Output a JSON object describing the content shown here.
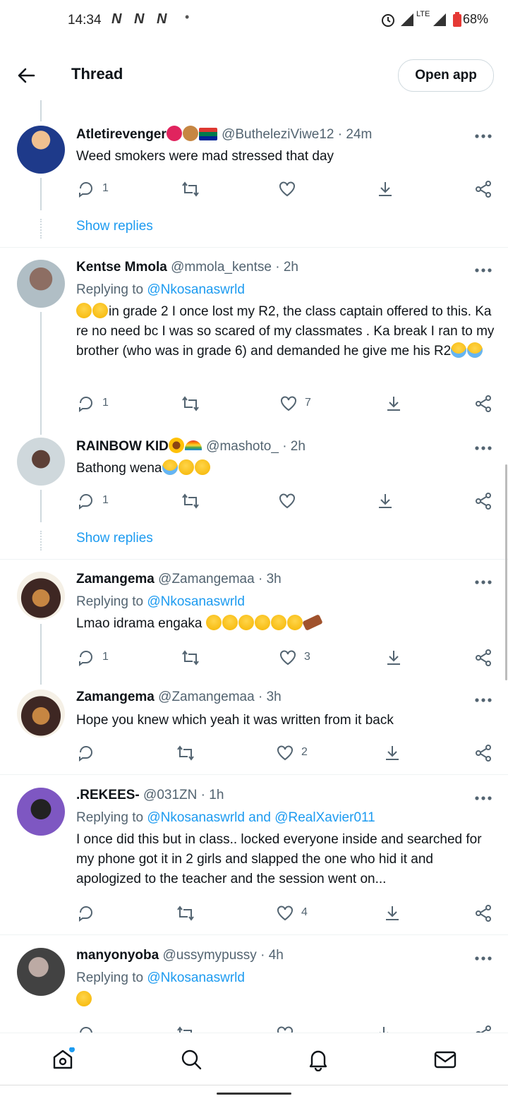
{
  "status_bar": {
    "time": "14:34",
    "network_badges": [
      "N",
      "N",
      "N"
    ],
    "lte": "LTE",
    "battery": "68%"
  },
  "header": {
    "title": "Thread",
    "open_app": "Open app"
  },
  "tweets": [
    {
      "name": "Atletirevenger",
      "handle": "@ButheleziViwe12",
      "time": "· 24m",
      "reply_to": "",
      "text": "Weed smokers were mad stressed that day",
      "replies": "1",
      "likes": "",
      "show_replies": "Show replies"
    },
    {
      "name": "Kentse Mmola",
      "handle": "@mmola_kentse",
      "time": "· 2h",
      "reply_prefix": "Replying to",
      "reply_to": "@Nkosanaswrld",
      "text": "in grade 2 I once lost my R2, the class captain offered to this. Ka re no need bc I was so scared of my classmates . Ka break I ran to my brother (who was in grade 6) and demanded he give me his R2",
      "replies": "1",
      "likes": "7"
    },
    {
      "name": "RAINBOW KID",
      "handle": "@mashoto_",
      "time": "· 2h",
      "text": "Bathong wena",
      "replies": "1",
      "likes": "",
      "show_replies": "Show replies"
    },
    {
      "name": "Zamangema",
      "handle": "@Zamangemaa",
      "time": "· 3h",
      "reply_prefix": "Replying to",
      "reply_to": "@Nkosanaswrld",
      "text": "Lmao idrama engaka",
      "replies": "1",
      "likes": "3"
    },
    {
      "name": "Zamangema",
      "handle": "@Zamangemaa",
      "time": "· 3h",
      "text": "Hope you knew which yeah it was written from it back",
      "replies": "",
      "likes": "2"
    },
    {
      "name": ".REKEES-",
      "handle": "@031ZN",
      "time": "· 1h",
      "reply_prefix": "Replying to",
      "reply_to": "@Nkosanaswrld",
      "reply_and": "and",
      "reply_to2": "@RealXavier011",
      "text": "I once did this but in class.. locked everyone inside and searched for my phone got it in 2 girls and slapped the one who hid it and apologized to the teacher and the session went on...",
      "replies": "",
      "likes": "4"
    },
    {
      "name": "manyonyoba",
      "handle": "@ussymypussy",
      "time": "· 4h",
      "reply_prefix": "Replying to",
      "reply_to": "@Nkosanaswrld",
      "text": ""
    }
  ],
  "icons": [
    "back-arrow-icon",
    "more-icon",
    "reply-icon",
    "retweet-icon",
    "like-icon",
    "download-icon",
    "share-icon",
    "home-icon",
    "search-icon",
    "notifications-icon",
    "messages-icon"
  ],
  "colors": {
    "accent": "#1d9bf0",
    "secondary_text": "#536471",
    "divider": "#eff3f4"
  }
}
